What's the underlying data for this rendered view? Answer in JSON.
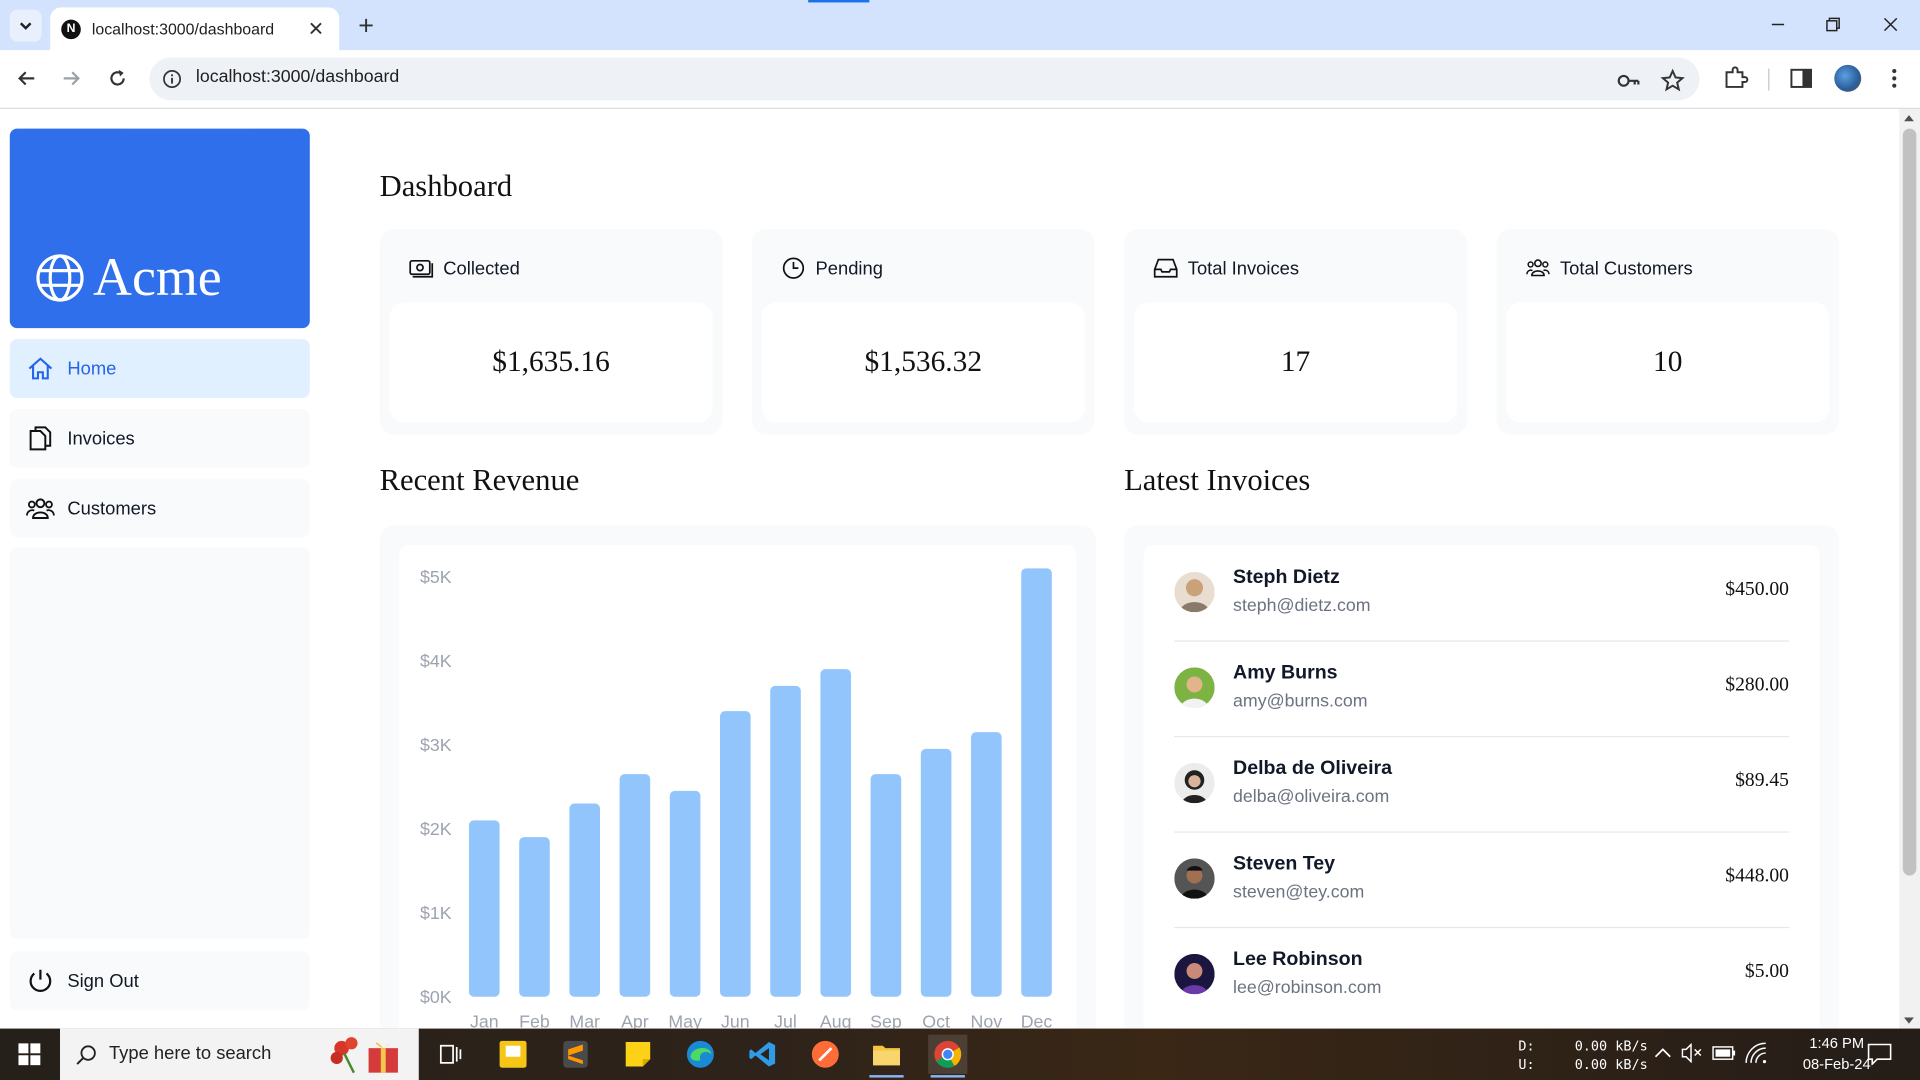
{
  "browser": {
    "tab_title": "localhost:3000/dashboard",
    "favicon_letter": "N",
    "url": "localhost:3000/dashboard"
  },
  "sidebar": {
    "logo_text": "Acme",
    "items": [
      {
        "label": "Home",
        "icon": "home-icon",
        "active": true
      },
      {
        "label": "Invoices",
        "icon": "document-icon",
        "active": false
      },
      {
        "label": "Customers",
        "icon": "users-icon",
        "active": false
      }
    ],
    "sign_out_label": "Sign Out"
  },
  "page": {
    "title": "Dashboard"
  },
  "cards": [
    {
      "label": "Collected",
      "value": "$1,635.16",
      "icon": "banknotes-icon"
    },
    {
      "label": "Pending",
      "value": "$1,536.32",
      "icon": "clock-icon"
    },
    {
      "label": "Total Invoices",
      "value": "17",
      "icon": "inbox-icon"
    },
    {
      "label": "Total Customers",
      "value": "10",
      "icon": "user-group-icon"
    }
  ],
  "revenue": {
    "title": "Recent Revenue"
  },
  "chart_data": {
    "type": "bar",
    "categories": [
      "Jan",
      "Feb",
      "Mar",
      "Apr",
      "May",
      "Jun",
      "Jul",
      "Aug",
      "Sep",
      "Oct",
      "Nov",
      "Dec"
    ],
    "values": [
      2100,
      1900,
      2300,
      2650,
      2450,
      3400,
      3700,
      3900,
      2650,
      2950,
      3150,
      5100
    ],
    "y_ticks": [
      "$5K",
      "$4K",
      "$3K",
      "$2K",
      "$1K",
      "$0K"
    ],
    "ylim": [
      0,
      5000
    ],
    "bar_color": "#93c5fd",
    "title": "",
    "xlabel": "",
    "ylabel": ""
  },
  "latest_invoices": {
    "title": "Latest Invoices",
    "rows": [
      {
        "name": "Steph Dietz",
        "email": "steph@dietz.com",
        "amount": "$450.00",
        "avatar_color": "#c9a27a"
      },
      {
        "name": "Amy Burns",
        "email": "amy@burns.com",
        "amount": "$280.00",
        "avatar_color": "#7cb342"
      },
      {
        "name": "Delba de Oliveira",
        "email": "delba@oliveira.com",
        "amount": "$89.45",
        "avatar_color": "#d8d8d8"
      },
      {
        "name": "Steven Tey",
        "email": "steven@tey.com",
        "amount": "$448.00",
        "avatar_color": "#3b3b3b"
      },
      {
        "name": "Lee Robinson",
        "email": "lee@robinson.com",
        "amount": "$5.00",
        "avatar_color": "#3f2a7a"
      }
    ]
  },
  "taskbar": {
    "search_placeholder": "Type here to search",
    "net_drive_d": "D:",
    "net_drive_u": "U:",
    "net_down": "0.00 kB/s",
    "net_up": "0.00 kB/s",
    "time": "1:46 PM",
    "date": "08-Feb-24"
  }
}
